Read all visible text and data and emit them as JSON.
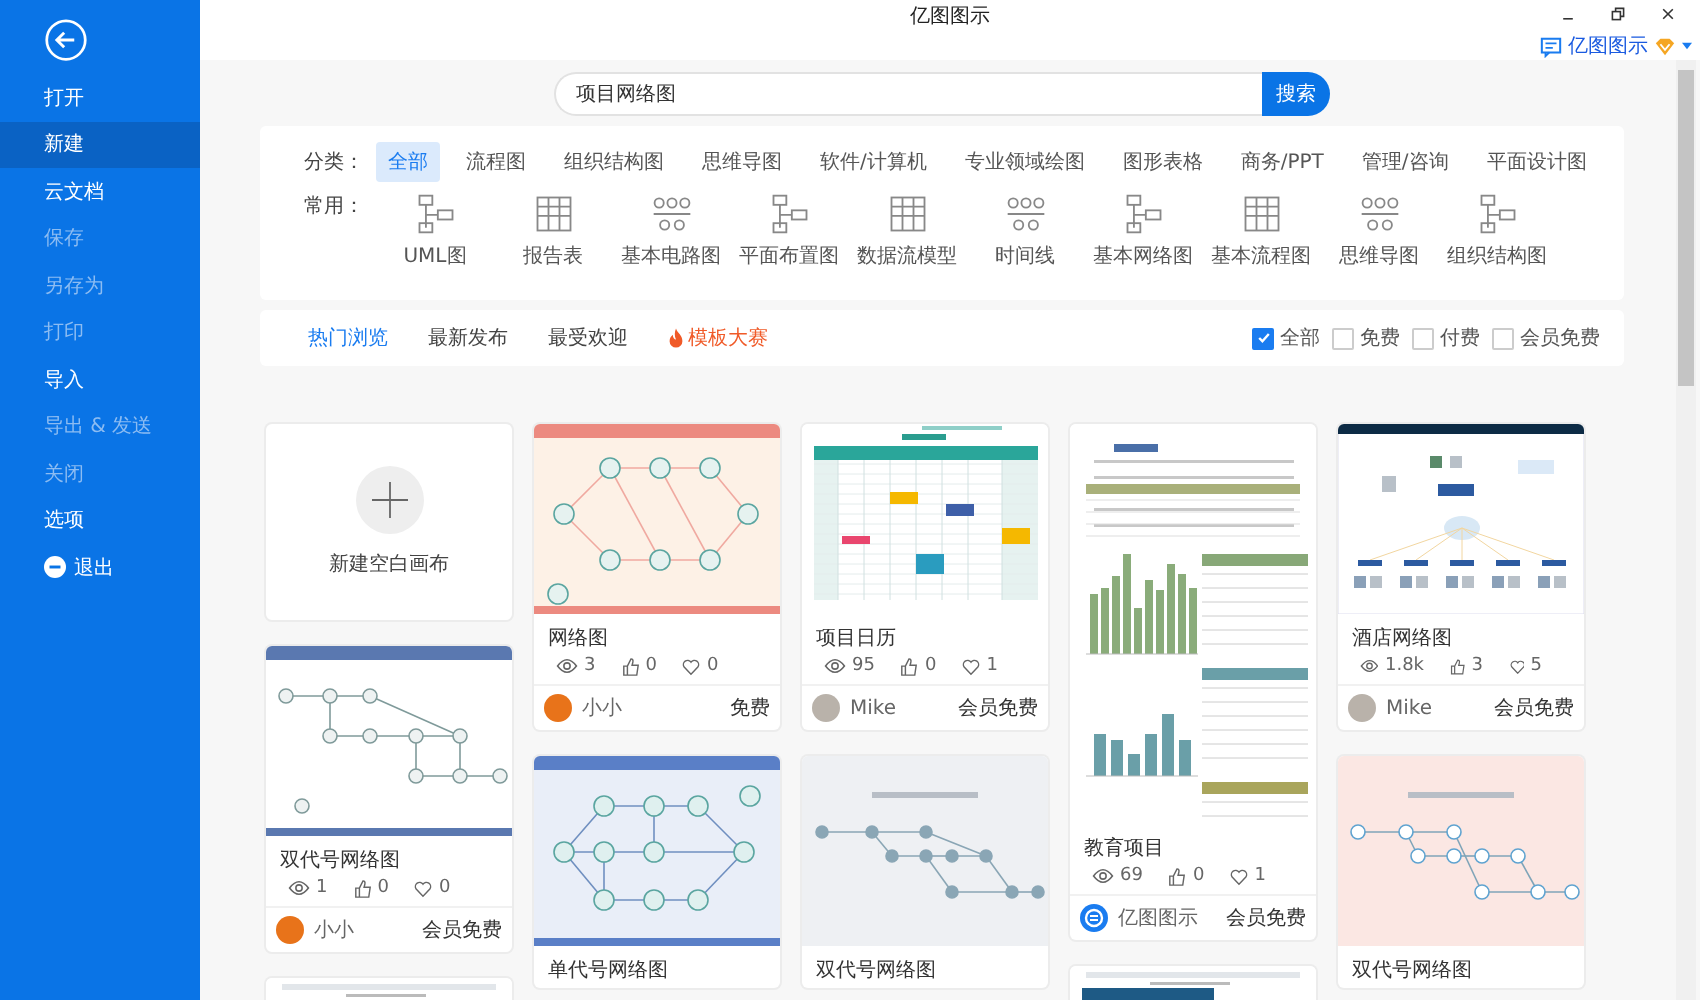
{
  "window": {
    "title": "亿图图示"
  },
  "account": {
    "name": "亿图图示"
  },
  "sidebar": {
    "items": [
      {
        "label": "打开",
        "kind": "item",
        "selected": false,
        "disabled": false
      },
      {
        "label": "新建",
        "kind": "item",
        "selected": true,
        "disabled": false
      },
      {
        "label": "云文档",
        "kind": "item",
        "selected": false,
        "disabled": false
      },
      {
        "label": "保存",
        "kind": "item",
        "selected": false,
        "disabled": true
      },
      {
        "label": "另存为",
        "kind": "item",
        "selected": false,
        "disabled": true
      },
      {
        "label": "打印",
        "kind": "item",
        "selected": false,
        "disabled": true
      },
      {
        "label": "导入",
        "kind": "item",
        "selected": false,
        "disabled": false
      },
      {
        "label": "导出 & 发送",
        "kind": "item",
        "selected": false,
        "disabled": true
      },
      {
        "label": "关闭",
        "kind": "item",
        "selected": false,
        "disabled": true
      },
      {
        "label": "选项",
        "kind": "item",
        "selected": false,
        "disabled": false
      },
      {
        "label": "退出",
        "kind": "exit",
        "selected": false,
        "disabled": false
      }
    ]
  },
  "search": {
    "value": "项目网络图",
    "button": "搜索"
  },
  "categories": {
    "label": "分类：",
    "items": [
      {
        "label": "全部",
        "selected": true
      },
      {
        "label": "流程图",
        "selected": false
      },
      {
        "label": "组织结构图",
        "selected": false
      },
      {
        "label": "思维导图",
        "selected": false
      },
      {
        "label": "软件/计算机",
        "selected": false
      },
      {
        "label": "专业领域绘图",
        "selected": false
      },
      {
        "label": "图形表格",
        "selected": false
      },
      {
        "label": "商务/PPT",
        "selected": false
      },
      {
        "label": "管理/咨询",
        "selected": false
      },
      {
        "label": "平面设计图",
        "selected": false
      }
    ]
  },
  "common": {
    "label": "常用：",
    "items": [
      "UML图",
      "报告表",
      "基本电路图",
      "平面布置图",
      "数据流模型",
      "时间线",
      "基本网络图",
      "基本流程图",
      "思维导图",
      "组织结构图"
    ]
  },
  "tabs": [
    {
      "label": "热门浏览",
      "selected": true,
      "kind": "plain"
    },
    {
      "label": "最新发布",
      "selected": false,
      "kind": "plain"
    },
    {
      "label": "最受欢迎",
      "selected": false,
      "kind": "plain"
    },
    {
      "label": "模板大赛",
      "selected": false,
      "kind": "hot"
    }
  ],
  "filters": [
    {
      "label": "全部",
      "checked": true
    },
    {
      "label": "免费",
      "checked": false
    },
    {
      "label": "付费",
      "checked": false
    },
    {
      "label": "会员免费",
      "checked": false
    }
  ],
  "columns": [
    [
      {
        "kind": "new",
        "label": "新建空白画布"
      },
      {
        "kind": "template",
        "thumb": {
          "kind": "dual"
        },
        "title": "双代号网络图",
        "stats": {
          "views": "1",
          "likes": "0",
          "favorites": "0"
        },
        "avatar": {
          "kind": "orange"
        },
        "author": "小小",
        "price": "会员免费"
      },
      {
        "kind": "partial",
        "thumb": {
          "kind": "doc"
        }
      }
    ],
    [
      {
        "kind": "template",
        "thumb": {
          "kind": "network"
        },
        "title": "网络图",
        "stats": {
          "views": "3",
          "likes": "0",
          "favorites": "0"
        },
        "avatar": {
          "kind": "orange"
        },
        "author": "小小",
        "price": "免费"
      },
      {
        "kind": "template",
        "thumb": {
          "kind": "single"
        },
        "title": "单代号网络图"
      }
    ],
    [
      {
        "kind": "template",
        "thumb": {
          "kind": "calendar"
        },
        "title": "项目日历",
        "stats": {
          "views": "95",
          "likes": "0",
          "favorites": "1"
        },
        "avatar": {
          "kind": "photo"
        },
        "author": "Mike",
        "price": "会员免费"
      },
      {
        "kind": "template",
        "thumb": {
          "kind": "plan"
        },
        "title": "双代号网络图"
      }
    ],
    [
      {
        "kind": "template",
        "thumb": {
          "kind": "report"
        },
        "title": "教育项目",
        "stats": {
          "views": "69",
          "likes": "0",
          "favorites": "1"
        },
        "avatar": {
          "kind": "logo"
        },
        "author": "亿图图示",
        "price": "会员免费"
      },
      {
        "kind": "partial",
        "thumb": {
          "kind": "doc"
        }
      }
    ],
    [
      {
        "kind": "template",
        "thumb": {
          "kind": "servers"
        },
        "title": "酒店网络图",
        "stats": {
          "views": "1.8k",
          "likes": "3",
          "favorites": "5"
        },
        "avatar": {
          "kind": "photo"
        },
        "author": "Mike",
        "price": "会员免费"
      },
      {
        "kind": "template",
        "thumb": {
          "kind": "pink"
        },
        "title": "双代号网络图"
      }
    ]
  ]
}
